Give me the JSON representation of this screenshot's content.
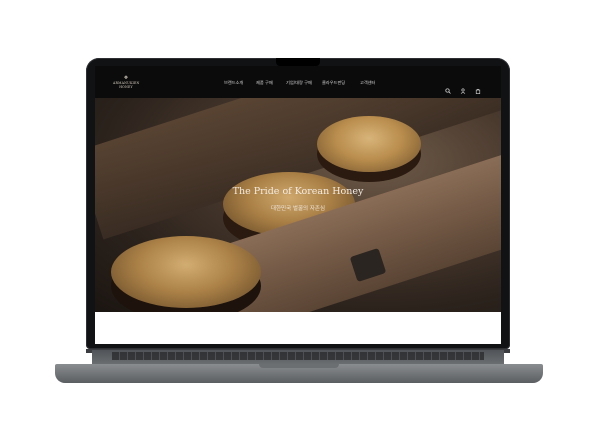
{
  "brand": {
    "logo_line1": "ARMANUKIEN",
    "logo_line2": "HONEY",
    "mark": "❖"
  },
  "nav": {
    "items": [
      {
        "label": "브랜드소개"
      },
      {
        "label": "제품 구매"
      },
      {
        "label": "기업/대량 구매"
      },
      {
        "label": "클라우드펀딩"
      },
      {
        "label": "고객센터"
      }
    ],
    "icons": [
      "search-icon",
      "user-icon",
      "cart-icon"
    ]
  },
  "hero": {
    "title": "The Pride of Korean Honey",
    "subtitle": "대한민국 벌꿀의 자존심"
  },
  "colors": {
    "nav_bg": "#0b0b0c",
    "hero_text": "#f2ece3",
    "gold": "#b98d4d"
  }
}
